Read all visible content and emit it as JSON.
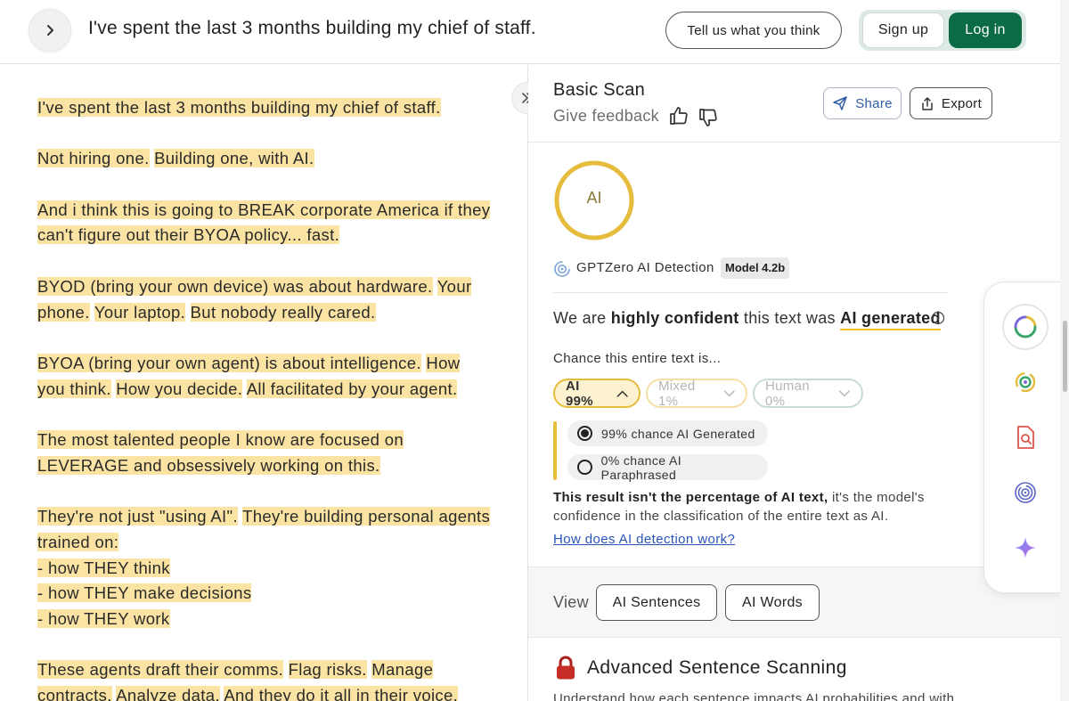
{
  "header": {
    "doc_title": "I've spent the last 3 months building my chief of staff.",
    "feedback_button": "Tell us what you think",
    "signup_button": "Sign up",
    "login_button": "Log in"
  },
  "document": {
    "paragraphs": [
      [
        [
          "I've spent the last 3 months building my chief of staff.",
          true
        ]
      ],
      [
        [
          "Not hiring one.",
          true
        ],
        [
          " ",
          false
        ],
        [
          "Building one, with AI.",
          true
        ]
      ],
      [
        [
          "And i think this is going to BREAK corporate America if they can't figure out their BYOA policy... fast.",
          true
        ]
      ],
      [
        [
          "BYOD (bring your own device) was about hardware.",
          true
        ],
        [
          " ",
          false
        ],
        [
          "Your phone.",
          true
        ],
        [
          " ",
          false
        ],
        [
          "Your laptop.",
          true
        ],
        [
          " ",
          false
        ],
        [
          "But nobody really cared.",
          true
        ]
      ],
      [
        [
          "BYOA (bring your own agent) is about intelligence.",
          true
        ],
        [
          " ",
          false
        ],
        [
          "How you think.",
          true
        ],
        [
          " ",
          false
        ],
        [
          "How you decide.",
          true
        ],
        [
          " ",
          false
        ],
        [
          "All facilitated by your agent.",
          true
        ]
      ],
      [
        [
          "The most talented people I know are focused on LEVERAGE and obsessively working on this.",
          true
        ]
      ],
      [
        [
          "They're not just \"using AI\".",
          true
        ],
        [
          " ",
          false
        ],
        [
          "They're building personal agents trained on:",
          true
        ],
        [
          "\n",
          false
        ],
        [
          "- how THEY think",
          true
        ],
        [
          "\n",
          false
        ],
        [
          "- how THEY make decisions",
          true
        ],
        [
          "\n",
          false
        ],
        [
          "- how THEY work",
          true
        ]
      ],
      [
        [
          "These agents draft their comms.",
          true
        ],
        [
          " ",
          false
        ],
        [
          "Flag risks.",
          true
        ],
        [
          " ",
          false
        ],
        [
          "Manage contracts.",
          true
        ],
        [
          " ",
          false
        ],
        [
          "Analyze data.",
          true
        ],
        [
          " ",
          false
        ],
        [
          "And they do it all in their voice.",
          true
        ]
      ]
    ],
    "highlight_color": "#fbe3a3"
  },
  "panel": {
    "scan_title": "Basic Scan",
    "give_feedback": "Give feedback",
    "share_button": "Share",
    "export_button": "Export",
    "ring_label": "AI",
    "ring_fraction": 0.99,
    "ring_color": "#e6bc3c",
    "detector_name": "GPTZero AI Detection",
    "model_badge": "Model 4.2b",
    "verdict": {
      "prefix": "We are ",
      "confidence": "highly confident",
      "middle": " this text was ",
      "result": "AI generated"
    },
    "chance_label": "Chance this entire text is...",
    "pills": {
      "ai": "AI 99%",
      "mixed": "Mixed 1%",
      "human": "Human 0%"
    },
    "sub_results": [
      {
        "label": "99% chance AI Generated",
        "selected": true
      },
      {
        "label": "0% chance AI Paraphrased",
        "selected": false
      }
    ],
    "note_bold": "This result isn't the percentage of AI text,",
    "note_rest": " it's the model's confidence in the classification of the entire text as AI.",
    "how_link": "How does AI detection work?",
    "view_label": "View",
    "view_buttons": [
      "AI Sentences",
      "AI Words"
    ],
    "advanced_title": "Advanced Sentence Scanning",
    "advanced_desc": "Understand how each sentence impacts AI probabilities and with"
  },
  "tools": [
    "detector-ring-icon",
    "target-icon",
    "doc-search-icon",
    "fingerprint-icon",
    "sparkle-icon"
  ]
}
